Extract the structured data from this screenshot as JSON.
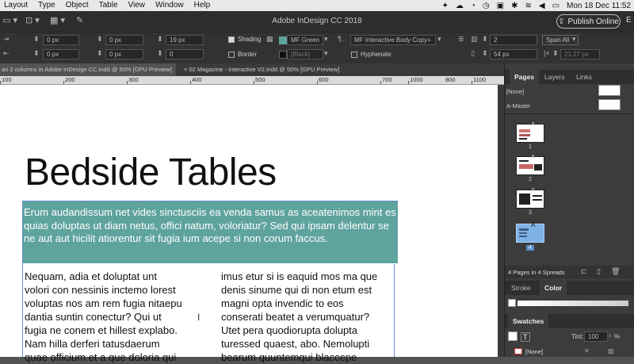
{
  "menubar": {
    "items": [
      "Layout",
      "Type",
      "Object",
      "Table",
      "View",
      "Window",
      "Help"
    ],
    "clock": "Mon 18 Dec  11:52"
  },
  "app": {
    "title": "Adobe InDesign CC 2018",
    "publish_label": "Publish Online",
    "edge_label": "E"
  },
  "control": {
    "field_a1": "0 px",
    "field_a2": "0 px",
    "field_b1": "0 px",
    "field_b2": "0 px",
    "field_c1": "19 px",
    "field_c2": "0",
    "shading_label": "Shading",
    "border_label": "Border",
    "shading_swatch": "MF Green",
    "border_swatch": "[Black]",
    "para_style": "MF Interactive Body Copy+",
    "hyphenate_label": "Hyphenate",
    "columns": "2",
    "span_label": "Span All",
    "gutter": "54 px",
    "width": "21.27 px"
  },
  "tabs": [
    {
      "label": "an 2 columns in Adobe InDesign CC.indd @ 50% [GPU Preview]",
      "active": true
    },
    {
      "label": "02 Magazine - Interactive V2.indd @ 50% [GPU Preview]",
      "active": false
    }
  ],
  "ruler": {
    "labels": [
      "100",
      "200",
      "300",
      "400",
      "500",
      "600",
      "700",
      "800",
      "900",
      "1000",
      "1100"
    ]
  },
  "document": {
    "headline": "Bedside Tables",
    "intro": "Erum audandissum net vides sinctusciis ea venda samus as aceatenimos mint es quias doluptas ut diam netus, offici natum, voloriatur? Sed qui ipsam delentur se ne aut aut hicilit atiorentur sit fugia ium acepe si non corum faccus.",
    "col1": "Nequam, adia et doluptat unt\nvolori con nessinis inctemo lorest\nvoluptas nos am rem fugia nitaepu\ndantia suntin conectur? Qui ut\nfugia ne conem et hillest explabo.\nNam hilla derferi tatusdaerum\nquae officium et a que doloria qui",
    "col2": "imus etur si is eaquid mos ma que\ndenis sinume qui di non etum est\nmagni opta invendic to eos\nconserati beatet a verumquatur?\nUtet pera quodiorupta dolupta\nturessed quaest, abo. Nemolupti\nbearum quuntemqui blaccepe"
  },
  "pages_panel": {
    "tabs": [
      "Pages",
      "Layers",
      "Links"
    ],
    "none_label": "[None]",
    "master_label": "A-Master",
    "thumbs": [
      {
        "num": "1",
        "letter": "A"
      },
      {
        "num": "2",
        "letter": "A"
      },
      {
        "num": "3",
        "letter": "A"
      },
      {
        "num": "4",
        "letter": "A"
      }
    ],
    "status": "4 Pages in 4 Spreads"
  },
  "color_panel": {
    "tabs": [
      "Stroke",
      "Color"
    ]
  },
  "swatches_panel": {
    "title": "Swatches",
    "tint_label": "Tint:",
    "tint_value": "100",
    "tint_unit": "%",
    "first_swatch": "[None]"
  },
  "colors": {
    "intro_bg": "#5fa39e",
    "shading": "#5fa39e",
    "selected_page": "#7fb2e6"
  }
}
